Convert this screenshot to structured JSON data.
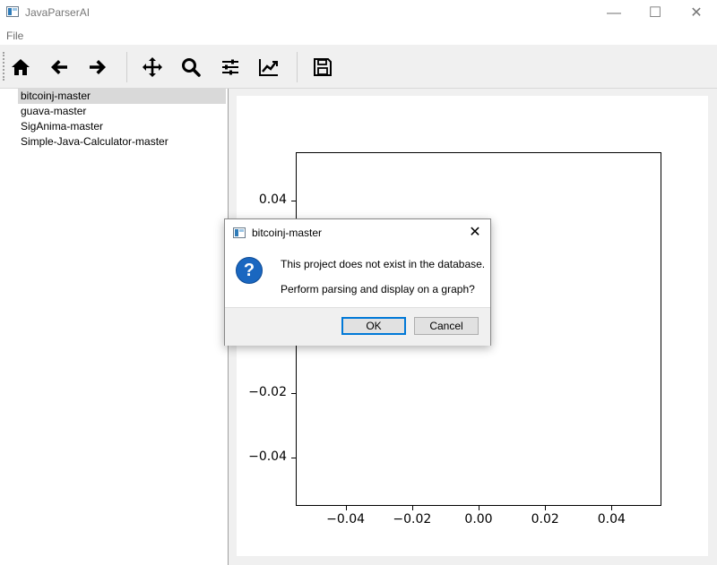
{
  "window": {
    "title": "JavaParserAI",
    "minimize": "—",
    "maximize": "☐",
    "close": "✕"
  },
  "menu": {
    "file": "File"
  },
  "toolbar": {
    "buttons": [
      {
        "name": "home",
        "icon": "home-icon"
      },
      {
        "name": "back",
        "icon": "arrow-left-icon"
      },
      {
        "name": "forward",
        "icon": "arrow-right-icon"
      },
      {
        "name": "pan",
        "icon": "move-icon"
      },
      {
        "name": "zoom",
        "icon": "magnifier-icon"
      },
      {
        "name": "configure-subplots",
        "icon": "sliders-icon"
      },
      {
        "name": "edit-axis",
        "icon": "line-chart-icon"
      },
      {
        "name": "save",
        "icon": "floppy-disk-icon"
      }
    ]
  },
  "projects": {
    "items": [
      "bitcoinj-master",
      "guava-master",
      "SigAnima-master",
      "Simple-Java-Calculator-master"
    ],
    "selected": "bitcoinj-master"
  },
  "chart_data": {
    "type": "scatter",
    "x": [],
    "y": [],
    "xlim": [
      -0.055,
      0.055
    ],
    "ylim": [
      -0.055,
      0.055
    ],
    "xticks": [
      "−0.04",
      "−0.02",
      "0.00",
      "0.02",
      "0.04"
    ],
    "xtick_values": [
      -0.04,
      -0.02,
      0.0,
      0.02,
      0.04
    ],
    "yticks": [
      "0.04",
      "−0.02",
      "−0.04"
    ],
    "ytick_values": [
      0.04,
      -0.02,
      -0.04
    ],
    "title": "",
    "xlabel": "",
    "ylabel": ""
  },
  "dialog": {
    "title": "bitcoinj-master",
    "icon": "question-icon",
    "icon_glyph": "?",
    "message": "This project does not exist in the database.",
    "question": "Perform parsing and display on a graph?",
    "ok_label": "OK",
    "cancel_label": "Cancel",
    "close": "✕"
  }
}
